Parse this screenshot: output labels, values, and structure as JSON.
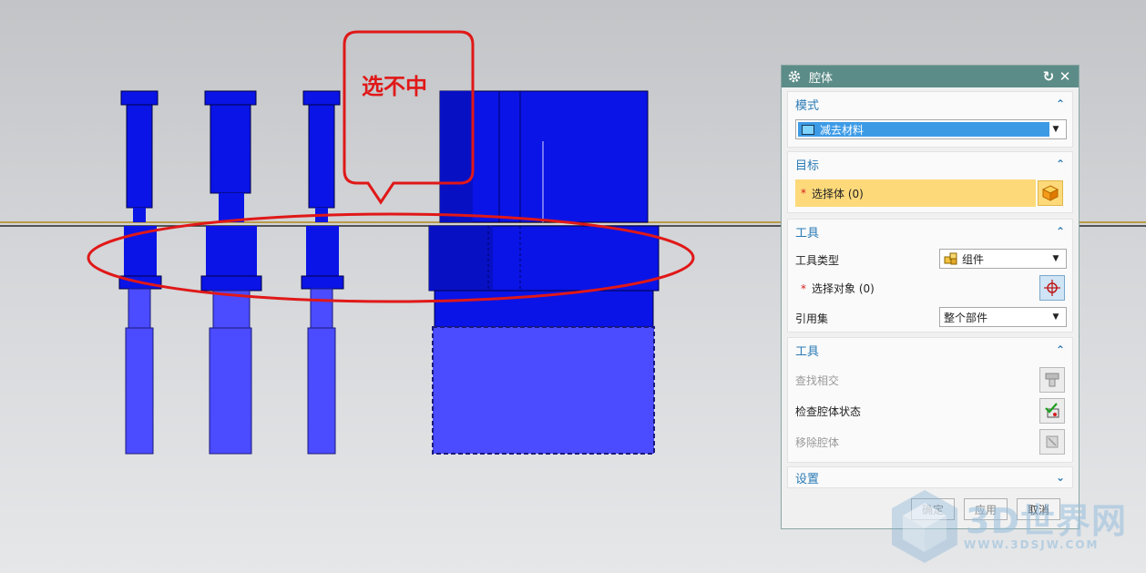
{
  "annotation": {
    "callout_text": "选不中"
  },
  "dialog": {
    "title": "腔体",
    "sections": {
      "mode": {
        "header": "模式",
        "dropdown_value": "减去材料"
      },
      "target": {
        "header": "目标",
        "select_label": "选择体 (0)"
      },
      "tool": {
        "header": "工具",
        "tool_type_label": "工具类型",
        "tool_type_value": "组件",
        "select_object_label": "选择对象 (0)",
        "reference_set_label": "引用集",
        "reference_set_value": "整个部件"
      },
      "tool2": {
        "header": "工具",
        "find_intersect_label": "查找相交",
        "check_cavity_label": "检查腔体状态",
        "remove_cavity_label": "移除腔体"
      },
      "settings": {
        "header": "设置"
      }
    },
    "footer": {
      "ok_label": "确定",
      "apply_label": "应用",
      "cancel_label": "取消"
    }
  },
  "watermark": {
    "text": "3D世界网",
    "url": "WWW.3DSJW.COM"
  },
  "colors": {
    "title_bar": "#5c8c88",
    "section_header": "#2b7bb5",
    "selection_highlight": "#fdd97a",
    "dropdown_selected": "#3d9be6",
    "part_blue": "#0a14e6",
    "part_light_blue": "#4b4bff",
    "annotation_red": "#e01818"
  },
  "icons": [
    "gear-icon",
    "reset-icon",
    "close-icon",
    "collapse-caret-icon",
    "expand-caret-icon",
    "solid-body-icon",
    "component-icon",
    "crosshair-icon",
    "find-intersect-icon",
    "check-cavity-icon",
    "remove-cavity-icon"
  ]
}
